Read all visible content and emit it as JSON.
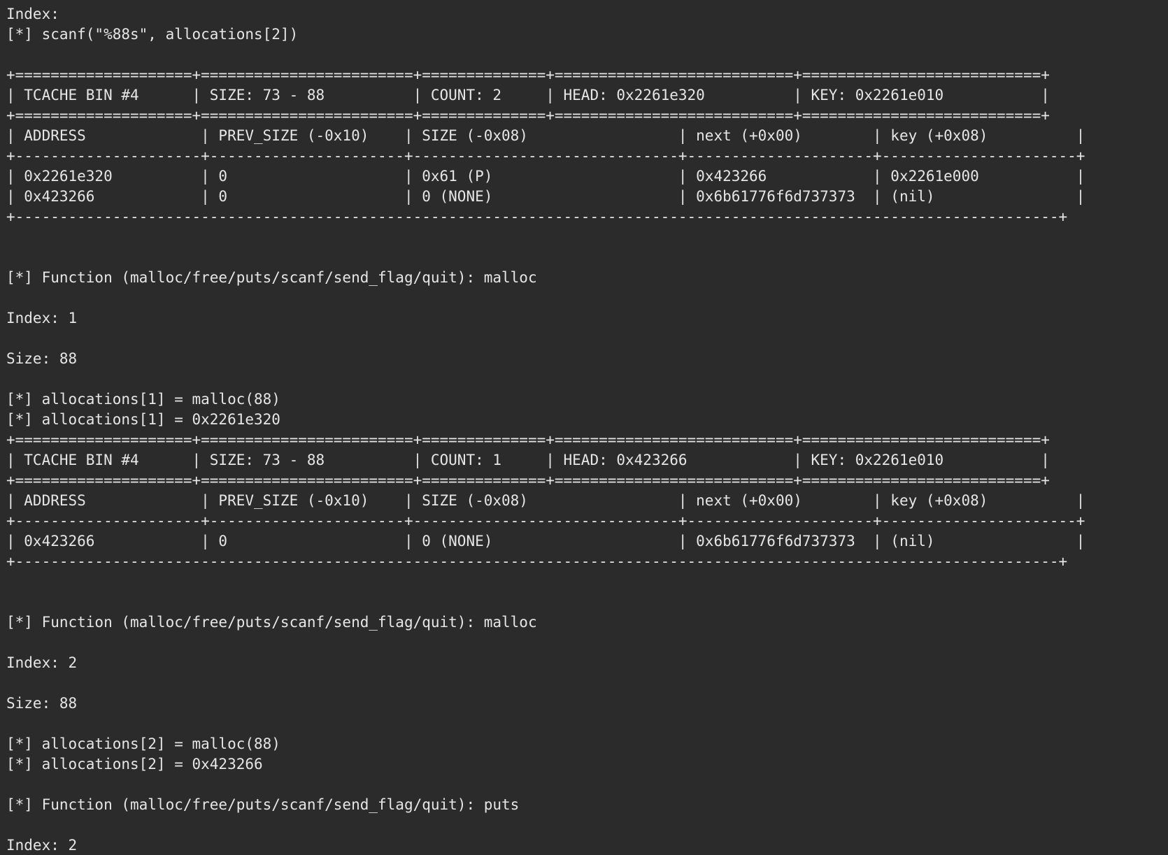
{
  "terminal": {
    "lines": [
      "Index:",
      "[*] scanf(\"%88s\", allocations[2])",
      "",
      "+====================+========================+==============+===========================+===========================+",
      "| TCACHE BIN #4      | SIZE: 73 - 88          | COUNT: 2     | HEAD: 0x2261e320          | KEY: 0x2261e010           |",
      "+====================+========================+==============+===========================+===========================+",
      "| ADDRESS             | PREV_SIZE (-0x10)    | SIZE (-0x08)                 | next (+0x00)        | key (+0x08)          |",
      "+---------------------+----------------------+------------------------------+---------------------+----------------------+",
      "| 0x2261e320          | 0                    | 0x61 (P)                     | 0x423266            | 0x2261e000           |",
      "| 0x423266            | 0                    | 0 (NONE)                     | 0x6b61776f6d737373  | (nil)                |",
      "+----------------------------------------------------------------------------------------------------------------------+",
      "",
      "",
      "[*] Function (malloc/free/puts/scanf/send_flag/quit): malloc",
      "",
      "Index: 1",
      "",
      "Size: 88",
      "",
      "[*] allocations[1] = malloc(88)",
      "[*] allocations[1] = 0x2261e320",
      "+====================+========================+==============+===========================+===========================+",
      "| TCACHE BIN #4      | SIZE: 73 - 88          | COUNT: 1     | HEAD: 0x423266            | KEY: 0x2261e010           |",
      "+====================+========================+==============+===========================+===========================+",
      "| ADDRESS             | PREV_SIZE (-0x10)    | SIZE (-0x08)                 | next (+0x00)        | key (+0x08)          |",
      "+---------------------+----------------------+------------------------------+---------------------+----------------------+",
      "| 0x423266            | 0                    | 0 (NONE)                     | 0x6b61776f6d737373  | (nil)                |",
      "+----------------------------------------------------------------------------------------------------------------------+",
      "",
      "",
      "[*] Function (malloc/free/puts/scanf/send_flag/quit): malloc",
      "",
      "Index: 2",
      "",
      "Size: 88",
      "",
      "[*] allocations[2] = malloc(88)",
      "[*] allocations[2] = 0x423266",
      "",
      "[*] Function (malloc/free/puts/scanf/send_flag/quit): puts",
      "",
      "Index: 2"
    ]
  },
  "colors": {
    "background": "#2b2b2b",
    "foreground": "#e6e6e6"
  }
}
